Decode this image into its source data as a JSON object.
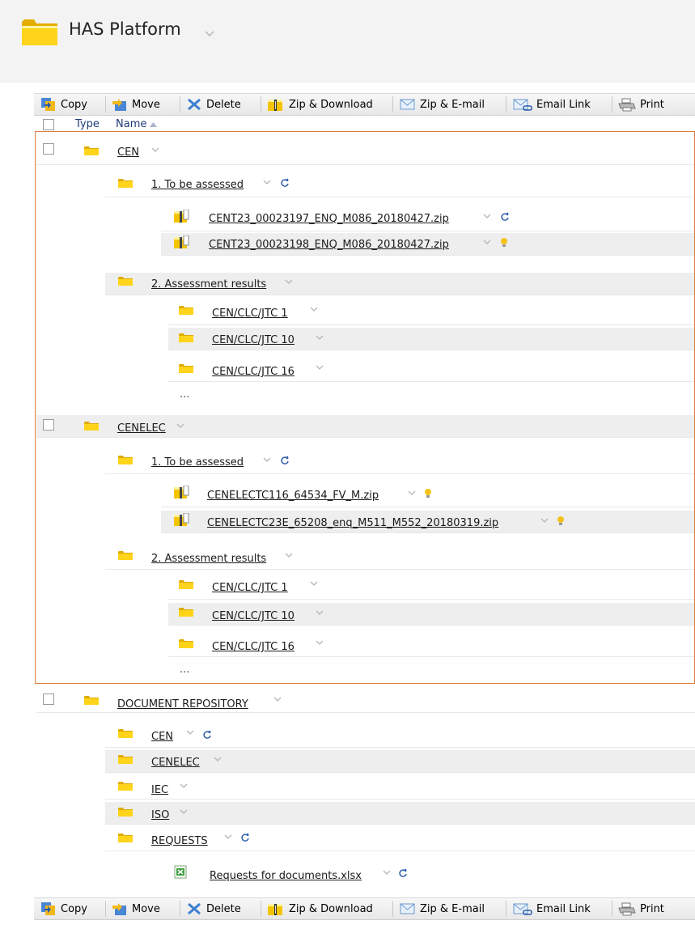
{
  "header": {
    "title": "HAS Platform"
  },
  "toolbar": {
    "copy": "Copy",
    "move": "Move",
    "delete": "Delete",
    "zip_download": "Zip & Download",
    "zip_email": "Zip & E-mail",
    "email_link": "Email Link",
    "print": "Print"
  },
  "columns": {
    "type": "Type",
    "name": "Name"
  },
  "tree": {
    "cen": {
      "label": "CEN",
      "to_be_assessed": "1. To be assessed",
      "file1": "CENT23_00023197_ENQ_M086_20180427.zip",
      "file2": "CENT23_00023198_ENQ_M086_20180427.zip",
      "assessment_results": "2. Assessment results",
      "jtc1": "CEN/CLC/JTC 1",
      "jtc10": "CEN/CLC/JTC 10",
      "jtc16": "CEN/CLC/JTC 16",
      "more": "..."
    },
    "cenelec": {
      "label": "CENELEC",
      "to_be_assessed": "1. To be assessed",
      "file1": "CENELECTC116_64534_FV_M.zip",
      "file2": "CENELECTC23E_65208_enq_M511_M552_20180319.zip",
      "assessment_results": "2. Assessment results",
      "jtc1": "CEN/CLC/JTC 1",
      "jtc10": "CEN/CLC/JTC 10",
      "jtc16": "CEN/CLC/JTC 16",
      "more": "..."
    },
    "repo": {
      "label": "DOCUMENT REPOSITORY",
      "cen": "CEN",
      "cenelec": "CENELEC",
      "iec": "IEC",
      "iso": "ISO",
      "requests": "REQUESTS",
      "requests_file": "Requests for documents.xlsx"
    }
  },
  "icons": {
    "folder": "folder-icon",
    "zip": "zip-file-icon",
    "excel": "excel-file-icon",
    "refresh": "refresh-icon",
    "tip": "lightbulb-icon",
    "chevron": "chevron-down-icon"
  },
  "colors": {
    "accent": "#e07a3c",
    "folder": "#f5c400"
  }
}
